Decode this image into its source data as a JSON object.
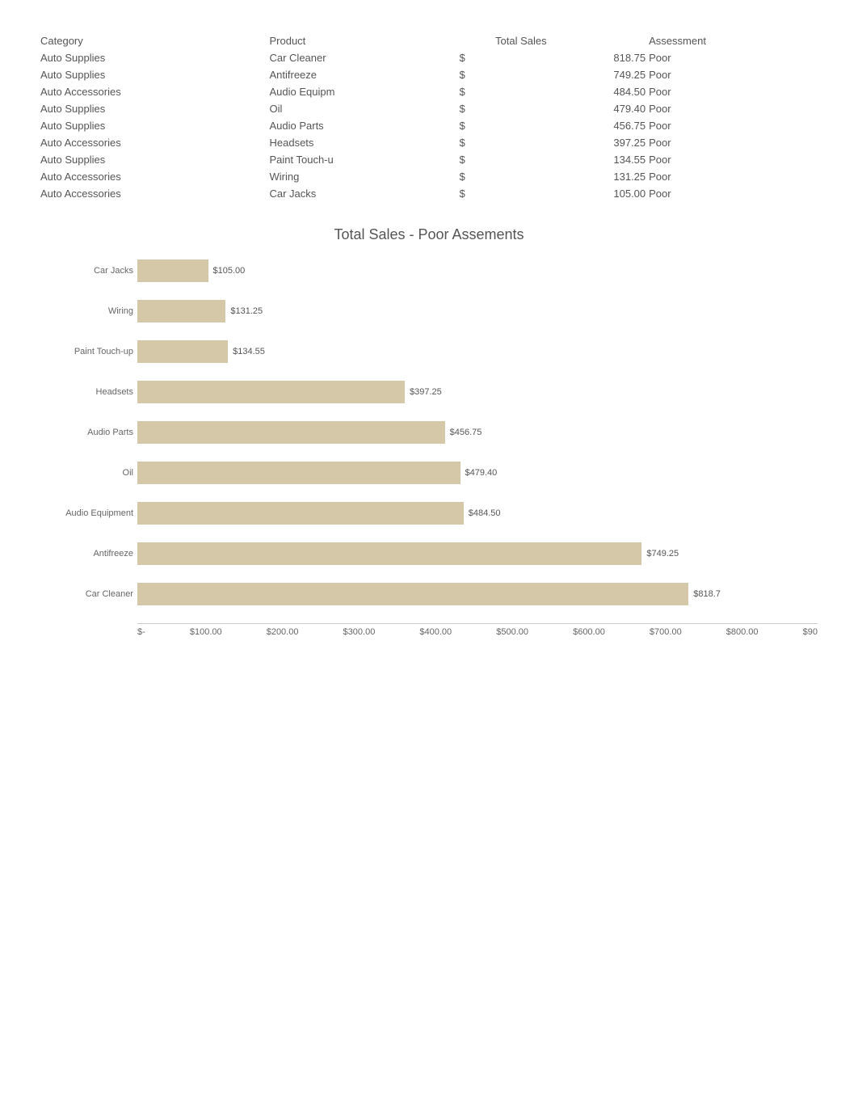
{
  "table": {
    "headers": [
      "Category",
      "Product",
      "",
      "Total Sales",
      "Assessment"
    ],
    "rows": [
      {
        "category": "Auto Supplies",
        "product": "Car Cleaner",
        "currency": "$",
        "amount": "818.75",
        "assessment": "Poor",
        "highlight": false
      },
      {
        "category": "Auto Supplies",
        "product": "Antifreeze",
        "currency": "$",
        "amount": "749.25",
        "assessment": "Poor",
        "highlight": false
      },
      {
        "category": "Auto Accessories",
        "product": "Audio Equipm",
        "currency": "$",
        "amount": "484.50",
        "assessment": "Poor",
        "highlight": false
      },
      {
        "category": "Auto Supplies",
        "product": "Oil",
        "currency": "$",
        "amount": "479.40",
        "assessment": "Poor",
        "highlight": false
      },
      {
        "category": "Auto Supplies",
        "product": "Audio Parts",
        "currency": "$",
        "amount": "456.75",
        "assessment": "Poor",
        "highlight": false
      },
      {
        "category": "Auto Accessories",
        "product": "Headsets",
        "currency": "$",
        "amount": "397.25",
        "assessment": "Poor",
        "highlight": false
      },
      {
        "category": "Auto Supplies",
        "product": "Paint Touch-u",
        "currency": "$",
        "amount": "134.55",
        "assessment": "Poor",
        "highlight": true
      },
      {
        "category": "Auto Accessories",
        "product": "Wiring",
        "currency": "$",
        "amount": "131.25",
        "assessment": "Poor",
        "highlight": true
      },
      {
        "category": "Auto Accessories",
        "product": "Car Jacks",
        "currency": "$",
        "amount": "105.00",
        "assessment": "Poor",
        "highlight": true
      }
    ]
  },
  "chart": {
    "title": "Total Sales - Poor Assements",
    "max_value": 900,
    "bars": [
      {
        "label": "Car Jacks",
        "value": 105.0,
        "display": "$105.00"
      },
      {
        "label": "Wiring",
        "value": 131.25,
        "display": "$131.25"
      },
      {
        "label": "Paint Touch-up",
        "value": 134.55,
        "display": "$134.55"
      },
      {
        "label": "Headsets",
        "value": 397.25,
        "display": "$397.25"
      },
      {
        "label": "Audio Parts",
        "value": 456.75,
        "display": "$456.75"
      },
      {
        "label": "Oil",
        "value": 479.4,
        "display": "$479.40"
      },
      {
        "label": "Audio Equipment",
        "value": 484.5,
        "display": "$484.50"
      },
      {
        "label": "Antifreeze",
        "value": 749.25,
        "display": "$749.25"
      },
      {
        "label": "Car Cleaner",
        "value": 818.75,
        "display": "$818.7"
      }
    ],
    "x_axis_labels": [
      "$-",
      "$100.00",
      "$200.00",
      "$300.00",
      "$400.00",
      "$500.00",
      "$600.00",
      "$700.00",
      "$800.00",
      "$90"
    ]
  }
}
